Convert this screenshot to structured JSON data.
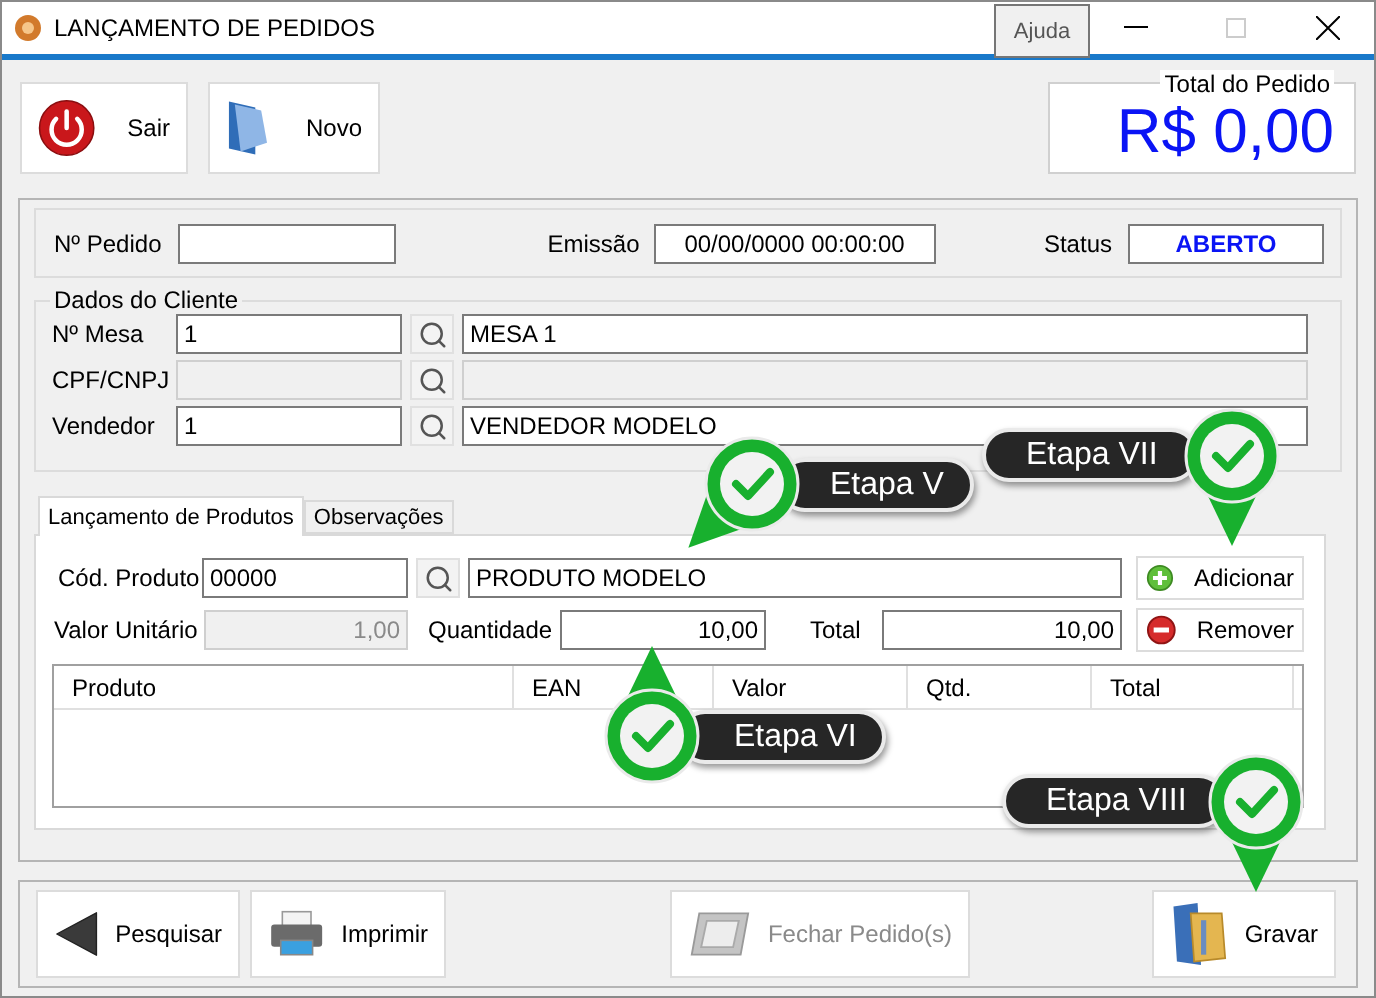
{
  "window": {
    "title": "LANÇAMENTO DE PEDIDOS",
    "tooltip": "Ajuda"
  },
  "toolbar": {
    "buttons": [
      {
        "label": "Sair",
        "kind": "power"
      },
      {
        "label": "Novo",
        "kind": "folder"
      }
    ]
  },
  "order_total": {
    "caption": "Total do Pedido",
    "value": "R$ 0,00"
  },
  "order_header": {
    "number_label": "Nº Pedido",
    "issue_label": "Emissão",
    "issue_date": "00/00/0000 00:00:00",
    "status_label": "Status",
    "status": "ABERTO"
  },
  "customer": {
    "title": "Dados do Cliente",
    "rows": [
      {
        "label": "Nº Mesa",
        "code": "1",
        "name": "MESA 1",
        "disabled": false
      },
      {
        "label": "CPF/CNPJ",
        "disabled": true
      },
      {
        "label": "Vendedor",
        "code": "1",
        "name": "VENDEDOR MODELO",
        "disabled": false
      }
    ]
  },
  "tabs": [
    {
      "label": "Lançamento de Produtos",
      "selected": true
    },
    {
      "label": "Observações",
      "selected": false
    }
  ],
  "product_entry": {
    "code_label": "Cód. Produto",
    "code": "00000",
    "name": "PRODUTO MODELO",
    "unit_price_label": "Valor Unitário",
    "unit_price": "1,00",
    "quantity_label": "Quantidade",
    "quantity": "10,00",
    "total_label": "Total",
    "total": "10,00",
    "actions": [
      {
        "label": "Adicionar",
        "kind": "add"
      },
      {
        "label": "Remover",
        "kind": "remove"
      }
    ]
  },
  "items_table": {
    "columns": [
      "Produto",
      "EAN",
      "Valor",
      "Qtd.",
      "Total"
    ]
  },
  "footer": {
    "buttons": [
      {
        "label": "Pesquisar",
        "kind": "back",
        "disabled": false
      },
      {
        "label": "Imprimir",
        "kind": "printer",
        "disabled": false
      },
      {
        "label": "Fechar Pedido(s)",
        "kind": "close-order",
        "disabled": true
      },
      {
        "label": "Gravar",
        "kind": "save",
        "disabled": false
      }
    ]
  },
  "callouts": [
    {
      "label": "Etapa V"
    },
    {
      "label": "Etapa VI"
    },
    {
      "label": "Etapa VII"
    },
    {
      "label": "Etapa VIII"
    }
  ]
}
